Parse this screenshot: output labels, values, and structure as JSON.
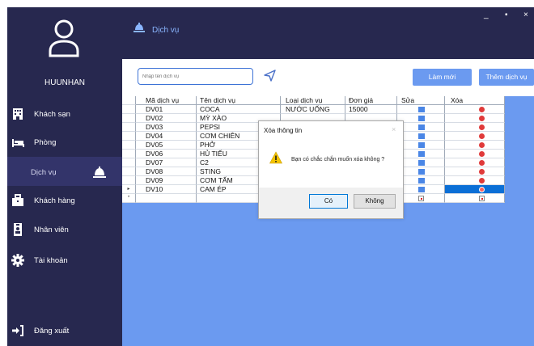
{
  "window": {
    "minimize_label": "_",
    "maximize_label": "▪",
    "close_label": "×"
  },
  "user": {
    "name": "HUUNHAN"
  },
  "sidebar": {
    "items": [
      {
        "label": "Khách sạn",
        "icon": "hotel-icon"
      },
      {
        "label": "Phòng",
        "icon": "bed-icon"
      },
      {
        "label": "Dịch vụ",
        "icon": "service-bell-icon"
      },
      {
        "label": "Khách hàng",
        "icon": "briefcase-icon"
      },
      {
        "label": "Nhân viên",
        "icon": "employee-badge-icon"
      },
      {
        "label": "Tài khoản",
        "icon": "gear-icon"
      }
    ],
    "logout_label": "Đăng xuất"
  },
  "header": {
    "title": "Dịch vụ"
  },
  "toolbar": {
    "search_placeholder": "Nhập tên dịch vụ",
    "refresh_label": "Làm mới",
    "add_label": "Thêm dịch vụ"
  },
  "table": {
    "columns": [
      "Mã dịch vụ",
      "Tên dịch vụ",
      "Loại dịch vụ",
      "Đơn giá",
      "Sửa",
      "Xóa"
    ],
    "rows": [
      {
        "id": "DV01",
        "name": "COCA",
        "type": "NƯỚC UỐNG",
        "price": "15000"
      },
      {
        "id": "DV02",
        "name": "MỲ XÀO",
        "type": "",
        "price": ""
      },
      {
        "id": "DV03",
        "name": "PEPSI",
        "type": "",
        "price": ""
      },
      {
        "id": "DV04",
        "name": "CƠM CHIÊN",
        "type": "",
        "price": ""
      },
      {
        "id": "DV05",
        "name": "PHỞ",
        "type": "",
        "price": ""
      },
      {
        "id": "DV06",
        "name": "HỦ TIẾU",
        "type": "",
        "price": ""
      },
      {
        "id": "DV07",
        "name": "C2",
        "type": "",
        "price": ""
      },
      {
        "id": "DV08",
        "name": "STING",
        "type": "",
        "price": ""
      },
      {
        "id": "DV09",
        "name": "CƠM TẤM",
        "type": "",
        "price": ""
      },
      {
        "id": "DV10",
        "name": "CAM ÉP",
        "type": "",
        "price": ""
      }
    ],
    "current_row_marker": "▸",
    "new_row_marker": "*"
  },
  "dialog": {
    "title": "Xóa thông tin",
    "message": "Bạn có chắc chắn muốn xóa không ?",
    "yes_label": "Có",
    "no_label": "Không",
    "close_label": "×",
    "icon": "warning-icon"
  },
  "colors": {
    "sidebar_bg": "#27284f",
    "accent": "#6b9af0",
    "header_title": "#8ab6ff",
    "delete": "#e03a3a",
    "edit": "#4a86e6"
  }
}
